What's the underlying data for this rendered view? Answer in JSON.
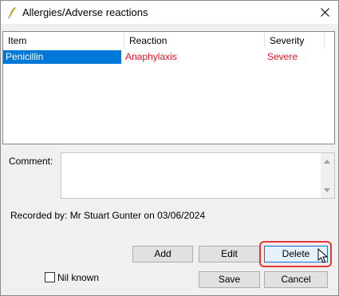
{
  "window": {
    "title": "Allergies/Adverse reactions"
  },
  "icons": {
    "app": "quill-icon",
    "close": "close-icon"
  },
  "table": {
    "columns": [
      "Item",
      "Reaction",
      "Severity"
    ],
    "rows": [
      {
        "item": "Penicillin",
        "reaction": "Anaphylaxis",
        "severity": "Severe"
      }
    ]
  },
  "comment": {
    "label": "Comment:",
    "value": ""
  },
  "recorded": {
    "text": "Recorded by: Mr Stuart Gunter on 03/06/2024"
  },
  "buttons": {
    "add": "Add",
    "edit": "Edit",
    "delete": "Delete",
    "save": "Save",
    "cancel": "Cancel"
  },
  "nil_known": {
    "label": "Nil known",
    "checked": false
  },
  "colors": {
    "selection": "#0078d7",
    "severe_text": "#e81123",
    "highlight": "#e03a3a"
  }
}
